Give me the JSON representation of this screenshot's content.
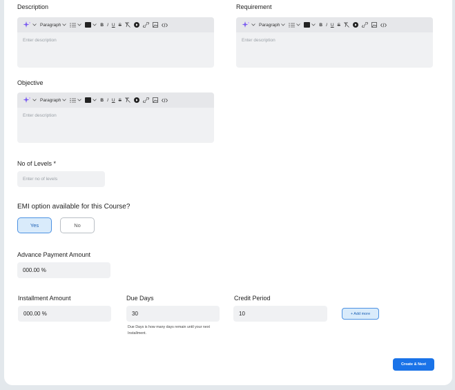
{
  "sections": {
    "description_label": "Description",
    "requirement_label": "Requirement",
    "objective_label": "Objective"
  },
  "toolbar": {
    "ai_icon": "sparkle-icon",
    "paragraph_label": "Paragraph",
    "color": "#222222"
  },
  "editors": {
    "description_placeholder": "Enter description",
    "requirement_placeholder": "Enter description",
    "objective_placeholder": "Enter description"
  },
  "levels": {
    "label": "No of Levels *",
    "placeholder": "Enter no of levels"
  },
  "emi": {
    "question": "EMI option available for this Course?",
    "yes_label": "Yes",
    "no_label": "No",
    "selected": "Yes"
  },
  "advance": {
    "label": "Advance Payment Amount",
    "value": "000.00 %"
  },
  "installment": {
    "amount_label": "Installment Amount",
    "amount_value": "000.00 %",
    "due_days_label": "Due Days",
    "due_days_value": "30",
    "due_days_help": "Due Days is how many days remain until your next Installment.",
    "credit_period_label": "Credit Period",
    "credit_period_value": "10",
    "add_more_label": "+ Add more"
  },
  "actions": {
    "create_next_label": "Create & Next"
  },
  "colors": {
    "accent": "#1a73e8",
    "selected_bg": "#d9ebfb",
    "field_bg": "#f0f1f3"
  }
}
